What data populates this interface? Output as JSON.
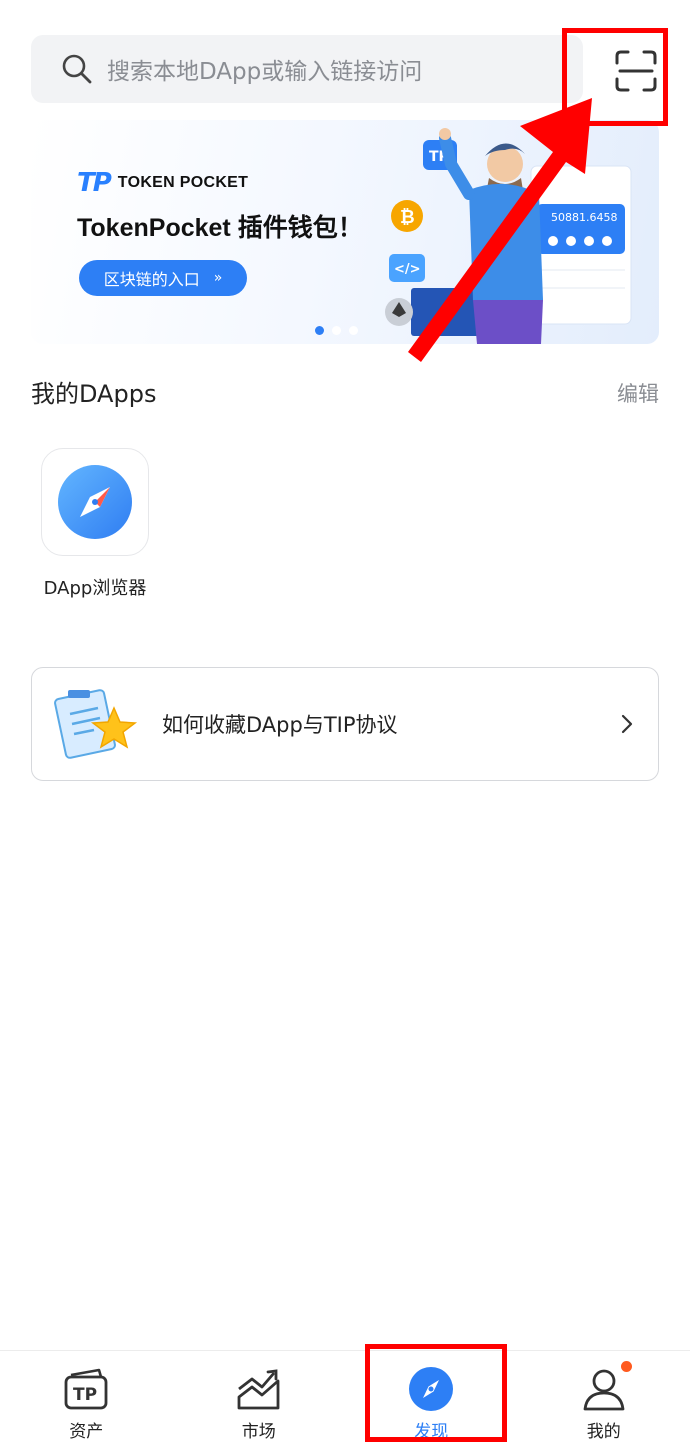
{
  "search": {
    "placeholder": "搜索本地DApp或输入链接访问"
  },
  "banner": {
    "brand": "TOKEN POCKET",
    "title": "TokenPocket 插件钱包！",
    "cta": "区块链的入口",
    "wallet_balance": "50881.6458",
    "active_slide": 1,
    "slide_count": 3
  },
  "my_dapps": {
    "title": "我的DApps",
    "edit": "编辑",
    "items": [
      {
        "label": "DApp浏览器",
        "icon": "compass-icon"
      }
    ]
  },
  "tip_card": {
    "text": "如何收藏DApp与TIP协议"
  },
  "bottom_nav": {
    "items": [
      {
        "label": "资产",
        "icon": "tp-wallet-icon",
        "active": false
      },
      {
        "label": "市场",
        "icon": "market-chart-icon",
        "active": false
      },
      {
        "label": "发现",
        "icon": "discover-compass-icon",
        "active": true
      },
      {
        "label": "我的",
        "icon": "profile-icon",
        "active": false,
        "badge": true
      }
    ]
  },
  "colors": {
    "accent": "#2d7ff5",
    "annotation": "#ff0000",
    "badge": "#ff5a1f",
    "muted_text": "#8a8d93"
  }
}
